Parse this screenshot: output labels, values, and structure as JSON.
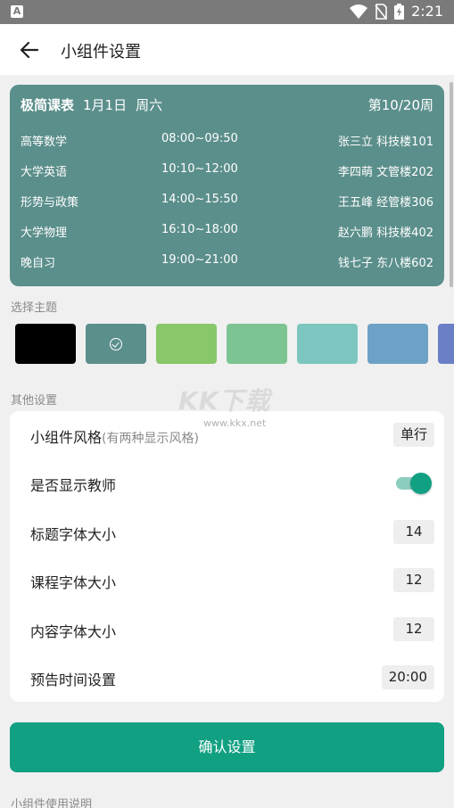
{
  "status_bar": {
    "time": "2:21",
    "notification_icon": "A"
  },
  "app_bar": {
    "title": "小组件设置"
  },
  "preview": {
    "brand": "极简课表",
    "date": "1月1日",
    "weekday": "周六",
    "week": "第10/20周",
    "rows": [
      {
        "name": "高等数学",
        "time": "08:00~09:50",
        "location": "张三立 科技楼101"
      },
      {
        "name": "大学英语",
        "time": "10:10~12:00",
        "location": "李四萌 文管楼202"
      },
      {
        "name": "形势与政策",
        "time": "14:00~15:50",
        "location": "王五峰 经管楼306"
      },
      {
        "name": "大学物理",
        "time": "16:10~18:00",
        "location": "赵六鹏 科技楼402"
      },
      {
        "name": "晚自习",
        "time": "19:00~21:00",
        "location": "钱七子 东八楼602"
      }
    ]
  },
  "theme": {
    "label": "选择主题",
    "swatches": [
      "#000000",
      "#5b8f8b",
      "#88c76a",
      "#7cc592",
      "#7cc6bf",
      "#6da1c6",
      "#6b7fc6"
    ],
    "selected_index": 1
  },
  "other": {
    "label": "其他设置",
    "style_label": "小组件风格",
    "style_hint": "(有两种显示风格)",
    "style_value": "单行",
    "show_teacher_label": "是否显示教师",
    "show_teacher_on": true,
    "title_font_label": "标题字体大小",
    "title_font_value": "14",
    "course_font_label": "课程字体大小",
    "course_font_value": "12",
    "content_font_label": "内容字体大小",
    "content_font_value": "12",
    "preview_time_label": "预告时间设置",
    "preview_time_value": "20:00"
  },
  "confirm_label": "确认设置",
  "usage_label": "小组件使用说明",
  "watermark": {
    "main": "KK下载",
    "url": "www.kkx.net"
  },
  "colors": {
    "accent": "#12a083",
    "preview_bg": "#5b8f8b",
    "status_bar": "#7a7a7a"
  }
}
